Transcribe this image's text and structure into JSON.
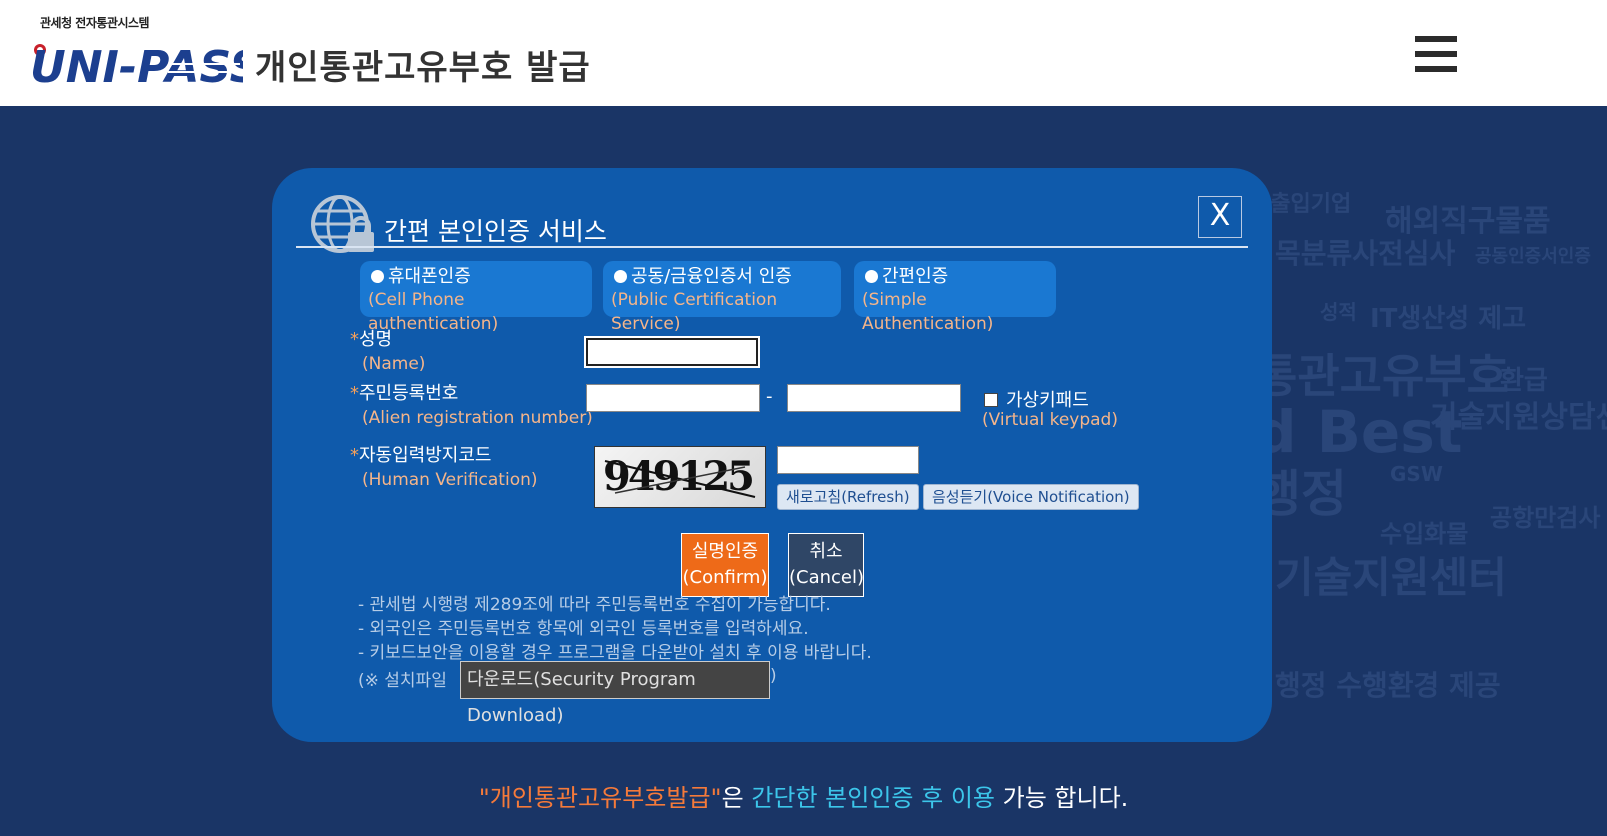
{
  "header": {
    "logo_sub": "관세청 전자통관시스템",
    "logo_text": "UNI-PASS",
    "title": "개인통관고유부호 발급",
    "menu_icon": "hamburger-menu-icon"
  },
  "background_words": [
    "수출입기업",
    "해외직구물품",
    "목분류사전심사",
    "공동인증서인증",
    "성적",
    "IT생산성 제고",
    "통관고유부호",
    "환급",
    "d Best",
    "기술지원상담센",
    "행정",
    "GSW",
    "수입화물",
    "공항만검사",
    "기술지원센터",
    "행정 수행환경 제공"
  ],
  "modal": {
    "title": "간편 본인인증 서비스",
    "close_label": "X",
    "tabs": [
      {
        "label": "휴대폰인증",
        "label_en": "(Cell Phone authentication)",
        "selected": false
      },
      {
        "label": "공동/금융인증서 인증",
        "label_en": "(Public Certification Service)",
        "selected": false
      },
      {
        "label": "간편인증",
        "label_en": "(Simple Authentication)",
        "selected": false
      }
    ],
    "required_mark": "*",
    "name_label": "성명",
    "name_label_en": "(Name)",
    "name_value": "",
    "reg_label": "주민등록번호",
    "reg_label_en": "(Alien registration number)",
    "reg_front_value": "",
    "reg_back_value": "",
    "reg_separator": "-",
    "virtual_keypad_label": "가상키패드",
    "virtual_keypad_label_en": "(Virtual keypad)",
    "virtual_keypad_checked": false,
    "captcha_label": "자동입력방지코드",
    "captcha_label_en": "(Human Verification)",
    "captcha_code": "949125",
    "captcha_input_value": "",
    "refresh_label": "새로고침(Refresh)",
    "voice_label": "음성듣기(Voice Notification)",
    "confirm_label": "실명인증",
    "confirm_label_en": "(Confirm)",
    "cancel_label": "취소",
    "cancel_label_en": "(Cancel)",
    "notes": [
      "- 관세법 시행령 제289조에 따라 주민등록번호 수집이 가능합니다.",
      "- 외국인은 주민등록번호 항목에 외국인 등록번호를 입력하세요.",
      "- 키보드보안을 이용할 경우 프로그램을 다운받아 설치 후 이용 바랍니다."
    ],
    "install_prefix": "(※ 설치파일",
    "download_label": "다운로드(Security Program Download)",
    "install_suffix": ")"
  },
  "footer": {
    "part1": "\"개인통관고유부호발급\"",
    "part2": "은 ",
    "part3": "간단한 본인인증 후 이용",
    "part4": " 가능 합니다."
  },
  "colors": {
    "background": "#1a3566",
    "modal": "#0f5aab",
    "tab": "#1a78d2",
    "confirm": "#ee6a18",
    "cancel": "#2f4666",
    "accent_orange": "#f57a3a",
    "accent_cyan": "#3cc6ea"
  }
}
